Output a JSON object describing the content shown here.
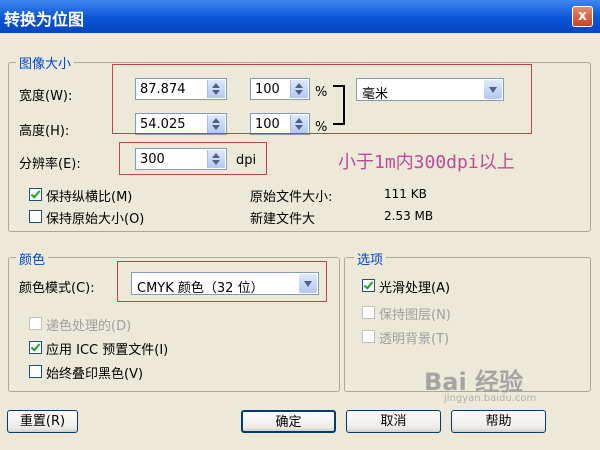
{
  "window": {
    "title": "转换为位图",
    "close_label": "x"
  },
  "image_size": {
    "legend": "图像大小",
    "width_label": "宽度(W):",
    "width_value": "87.874",
    "width_percent": "100",
    "height_label": "高度(H):",
    "height_value": "54.025",
    "height_percent": "100",
    "percent_symbol": "%",
    "unit": "毫米",
    "resolution_label": "分辨率(E):",
    "resolution_value": "300",
    "resolution_unit": "dpi",
    "keep_ratio_label": "保持纵横比(M)",
    "keep_original_label": "保持原始大小(O)",
    "original_size_label": "原始文件大小:",
    "original_size_value": "111 KB",
    "new_size_label": "新建文件大",
    "new_size_value": "2.53 MB"
  },
  "annotation": "小于1m内300dpi以上",
  "color": {
    "legend": "颜色",
    "mode_label": "颜色模式(C):",
    "mode_value": "CMYK 颜色（32 位）",
    "dither_label": "递色处理的(D)",
    "icc_label": "应用 ICC 预置文件(I)",
    "overprint_label": "始终叠印黑色(V)"
  },
  "options": {
    "legend": "选项",
    "smooth_label": "光滑处理(A)",
    "keep_layers_label": "保持图层(N)",
    "transparent_label": "透明背景(T)"
  },
  "buttons": {
    "reset": "重置(R)",
    "ok": "确定",
    "cancel": "取消",
    "help": "帮助"
  },
  "watermark": {
    "main": "Bai 经验",
    "sub": "jingyan.baidu.com"
  }
}
